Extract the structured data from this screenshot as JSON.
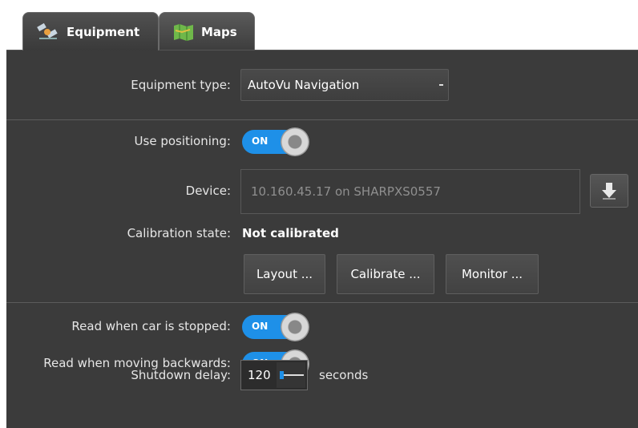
{
  "tabs": [
    {
      "label": "Equipment",
      "icon": "satellite-icon",
      "active": true
    },
    {
      "label": "Maps",
      "icon": "map-icon",
      "active": false
    }
  ],
  "equipment_type": {
    "label": "Equipment type:",
    "value": "AutoVu Navigation"
  },
  "use_positioning": {
    "label": "Use positioning:",
    "toggle": "ON"
  },
  "device": {
    "label": "Device:",
    "value": "10.160.45.17 on SHARPXS0557",
    "button_icon": "download-icon"
  },
  "calibration": {
    "label": "Calibration state:",
    "value": "Not calibrated"
  },
  "buttons": {
    "layout": "Layout ...",
    "calibrate": "Calibrate ...",
    "monitor": "Monitor ..."
  },
  "read_stopped": {
    "label": "Read when car is stopped:",
    "toggle": "ON"
  },
  "read_backwards": {
    "label": "Read when moving backwards:",
    "toggle": "ON"
  },
  "shutdown": {
    "label": "Shutdown delay:",
    "value": "120",
    "unit": "seconds"
  },
  "colors": {
    "accent": "#1e90e8",
    "panel": "#3b3b3b"
  }
}
